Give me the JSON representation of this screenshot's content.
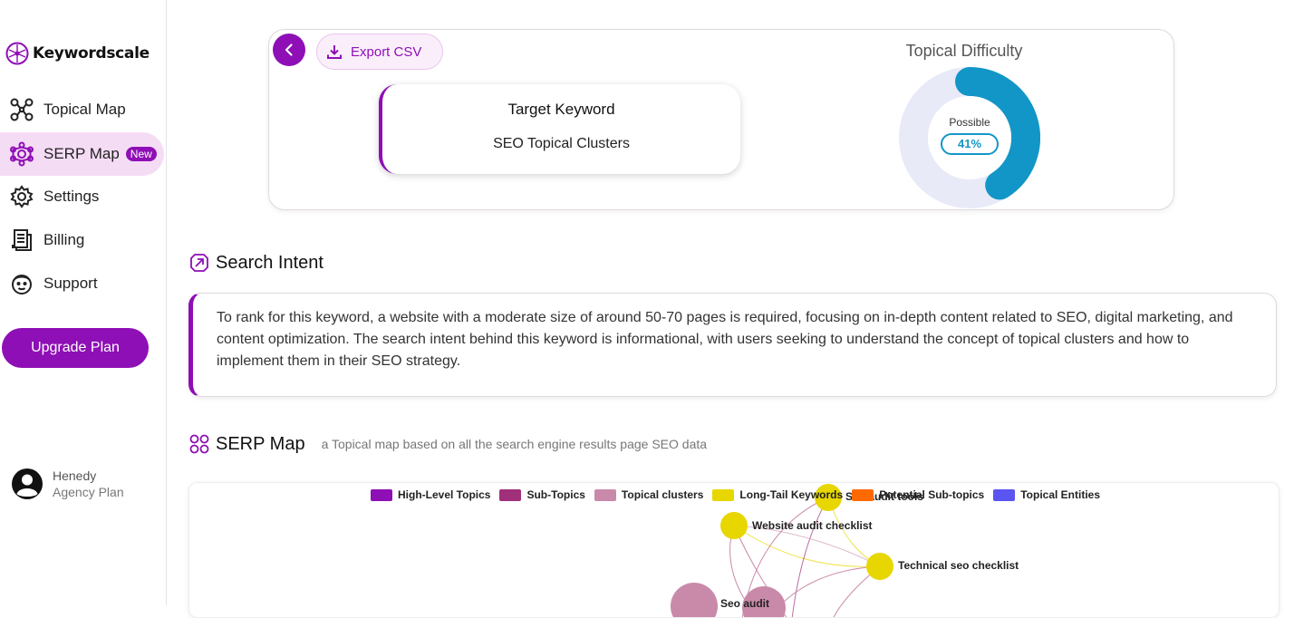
{
  "app": {
    "name": "Keywordscale"
  },
  "sidebar": {
    "items": [
      {
        "label": "Topical Map",
        "icon": "topical-map-icon"
      },
      {
        "label": "SERP Map",
        "icon": "serp-map-icon",
        "badge": "New",
        "active": true
      },
      {
        "label": "Settings",
        "icon": "settings-icon"
      },
      {
        "label": "Billing",
        "icon": "billing-icon"
      },
      {
        "label": "Support",
        "icon": "support-icon"
      }
    ],
    "upgrade_label": "Upgrade Plan",
    "user": {
      "name": "Henedy",
      "plan": "Agency Plan"
    }
  },
  "toolbar": {
    "export_label": "Export CSV"
  },
  "target": {
    "title": "Target Keyword",
    "keyword": "SEO Topical Clusters"
  },
  "difficulty": {
    "title": "Topical Difficulty",
    "label": "Possible",
    "percent_text": "41%",
    "value": 0.41,
    "color": "#1296c7",
    "track_color": "#e8eaf8"
  },
  "intent": {
    "title": "Search Intent",
    "text": "To rank for this keyword, a website with a moderate size of around 50-70 pages is required, focusing on in-depth content related to SEO, digital marketing, and content optimization. The search intent behind this keyword is informational, with users seeking to understand the concept of topical clusters and how to implement them in their SEO strategy."
  },
  "serp_map": {
    "title": "SERP Map",
    "subtitle": "a Topical map based on all the search engine results page SEO data",
    "legend": [
      {
        "label": "High-Level Topics",
        "color": "#8e0fb5"
      },
      {
        "label": "Sub-Topics",
        "color": "#a0307a"
      },
      {
        "label": "Topical clusters",
        "color": "#c98aaa"
      },
      {
        "label": "Long-Tail Keywords",
        "color": "#e8d600"
      },
      {
        "label": "Potential Sub-topics",
        "color": "#ff6a00"
      },
      {
        "label": "Topical Entities",
        "color": "#5a55f0"
      }
    ],
    "nodes": [
      {
        "label": "Seo audit tools"
      },
      {
        "label": "Website audit checklist"
      },
      {
        "label": "Technical seo checklist"
      },
      {
        "label": "Seo audit"
      }
    ]
  },
  "colors": {
    "accent": "#8e0fb5",
    "accent_light": "#f5dcf5"
  }
}
